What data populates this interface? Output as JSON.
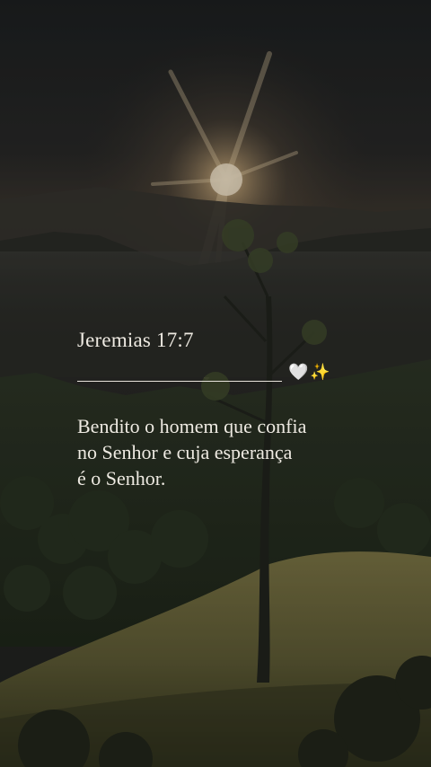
{
  "verse": {
    "reference": "Jeremias 17:7",
    "text_lines": [
      "Bendito o homem que confia",
      "no Senhor e cuja esperança",
      "é o Senhor."
    ]
  },
  "decor": {
    "heart_icon": "🤍",
    "sparkles_icon": "✨"
  },
  "colors": {
    "text": "#eeeae2",
    "sun_glow": "#f3dcae",
    "grass": "#6e6a3c"
  }
}
